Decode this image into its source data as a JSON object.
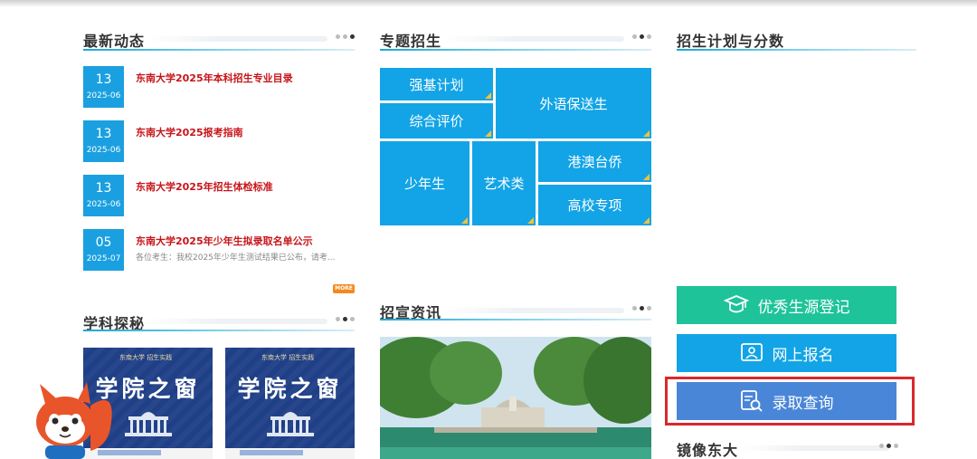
{
  "sections": {
    "news": {
      "title": "最新动态",
      "more_label": "MORE"
    },
    "special": {
      "title": "专题招生"
    },
    "plan": {
      "title": "招生计划与分数"
    },
    "discipline": {
      "title": "学科探秘"
    },
    "promo": {
      "title": "招宣资讯"
    },
    "mirror": {
      "title": "镜像东大"
    }
  },
  "news_items": [
    {
      "day": "13",
      "ym": "2025-06",
      "title": "东南大学2025年本科招生专业目录",
      "desc": ""
    },
    {
      "day": "13",
      "ym": "2025-06",
      "title": "东南大学2025报考指南",
      "desc": ""
    },
    {
      "day": "13",
      "ym": "2025-06",
      "title": "东南大学2025年招生体检标准",
      "desc": ""
    },
    {
      "day": "05",
      "ym": "2025-07",
      "title": "东南大学2025年少年生拟录取名单公示",
      "desc": "各位考生：我校2025年少年生测试结果已公布，请考..."
    }
  ],
  "tiles": {
    "qiangji": "强基计划",
    "waiyu": "外语保送生",
    "zonghe": "综合评价",
    "shaonian": "少年生",
    "yishu": "艺术类",
    "gangao": "港澳台侨",
    "gaoxiao": "高校专项"
  },
  "cards": [
    {
      "brand": "东南大学 招生实践",
      "big": "学院之窗"
    },
    {
      "brand": "东南大学 招生实践",
      "big": "学院之窗"
    }
  ],
  "actions": {
    "register": "优秀生源登记",
    "apply": "网上报名",
    "admission": "录取查询"
  },
  "colors": {
    "accent": "#12a4e6",
    "news_title": "#c7151a",
    "register_bg": "#1ec39a",
    "apply_bg": "#12a4e6",
    "admission_bg": "#4a86d8",
    "highlight": "#d9282f"
  }
}
